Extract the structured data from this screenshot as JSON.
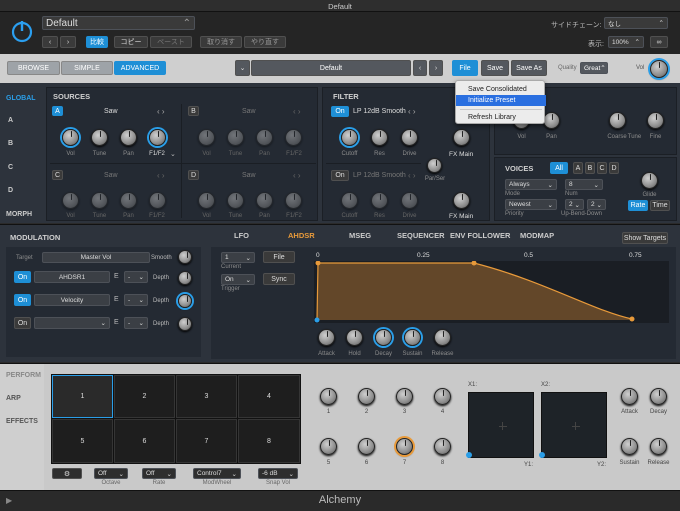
{
  "window": {
    "title": "Default",
    "footer_title": "Alchemy"
  },
  "header": {
    "preset": "Default",
    "compare": "比較",
    "copy": "コピー",
    "paste": "ペースト",
    "undo": "取り消す",
    "redo": "やり直す",
    "sidechain_label": "サイドチェーン:",
    "sidechain_value": "なし",
    "view_label": "表示:",
    "view_value": "100%"
  },
  "toolbar": {
    "browse": "BROWSE",
    "simple": "SIMPLE",
    "advanced": "ADVANCED",
    "preset_name": "Default",
    "file": "File",
    "save": "Save",
    "save_as": "Save As",
    "quality_label": "Quality",
    "quality_value": "Great",
    "vol_label": "Vol"
  },
  "file_menu": {
    "items": [
      "Save Consolidated",
      "Initialize Preset",
      "Refresh Library"
    ]
  },
  "side_nav": [
    "GLOBAL",
    "A",
    "B",
    "C",
    "D",
    "MORPH"
  ],
  "sources": {
    "title": "SOURCES",
    "slots": [
      {
        "letter": "A",
        "name": "Saw",
        "knobs": [
          "Vol",
          "Tune",
          "Pan",
          "F1/F2"
        ]
      },
      {
        "letter": "B",
        "name": "Saw",
        "knobs": [
          "Vol",
          "Tune",
          "Pan",
          "F1/F2"
        ]
      },
      {
        "letter": "C",
        "name": "Saw",
        "knobs": [
          "Vol",
          "Tune",
          "Pan",
          "F1/F2"
        ]
      },
      {
        "letter": "D",
        "name": "Saw",
        "knobs": [
          "Vol",
          "Tune",
          "Pan",
          "F1/F2"
        ]
      }
    ]
  },
  "filter": {
    "title": "FILTER",
    "filters": [
      {
        "on": "On",
        "type": "LP 12dB Smooth",
        "knobs": [
          "Cutoff",
          "Res",
          "Drive"
        ],
        "route": "FX Main"
      },
      {
        "on": "On",
        "type": "LP 12dB Smooth",
        "knobs": [
          "Cutoff",
          "Res",
          "Drive"
        ],
        "route": "FX Main"
      }
    ],
    "par_ser": "Par/Ser"
  },
  "amp": {
    "knobs": [
      "Vol",
      "Pan",
      "Coarse",
      "Tune",
      "Fine"
    ]
  },
  "voices": {
    "title": "VOICES",
    "all": "All",
    "letters": [
      "A",
      "B",
      "C",
      "D"
    ],
    "mode_value": "Always",
    "mode_label": "Mode",
    "num_value": "8",
    "num_label": "Num",
    "priority_value": "Newest",
    "priority_label": "Priority",
    "up_value": "2",
    "down_value": "2",
    "updown_label": "Up-Bend-Down",
    "glide_label": "Glide",
    "rate": "Rate",
    "time": "Time"
  },
  "modulation": {
    "title": "MODULATION",
    "target_label": "Target",
    "target_value": "Master Vol",
    "smooth_label": "Smooth",
    "rows": [
      {
        "on": "On",
        "source": "AHDSR1",
        "e": "E",
        "dash": "-",
        "depth": "Depth"
      },
      {
        "on": "On",
        "source": "Velocity",
        "e": "E",
        "dash": "-",
        "depth": "Depth"
      },
      {
        "on": "On",
        "source": "",
        "e": "E",
        "dash": "-",
        "depth": "Depth"
      }
    ]
  },
  "mod_tabs": [
    "LFO",
    "AHDSR",
    "MSEG",
    "SEQUENCER",
    "ENV FOLLOWER",
    "MODMAP"
  ],
  "show_targets": "Show Targets",
  "ahdsr": {
    "current_value": "1",
    "current_label": "Current",
    "file": "File",
    "trigger_value": "On",
    "trigger_label": "Trigger",
    "sync": "Sync",
    "ruler": [
      "0",
      "0.25",
      "0.5",
      "0.75"
    ],
    "knobs": [
      "Attack",
      "Hold",
      "Decay",
      "Sustain",
      "Release"
    ]
  },
  "perform": {
    "nav": [
      "PERFORM",
      "ARP",
      "EFFECTS"
    ],
    "pads": [
      "1",
      "2",
      "3",
      "4",
      "5",
      "6",
      "7",
      "8"
    ],
    "octave_value": "Off",
    "octave_label": "Octave",
    "rate_value": "Off",
    "rate_label": "Rate",
    "modwheel_value": "Control7",
    "modwheel_label": "ModWheel",
    "snapvol_value": "-6 dB",
    "snapvol_label": "Snap Vol",
    "knobs": [
      "1",
      "2",
      "3",
      "4",
      "5",
      "6",
      "7",
      "8"
    ],
    "xy": [
      "X1:",
      "Y1:",
      "X2:",
      "Y2:"
    ],
    "right_knobs": [
      "Attack",
      "Decay",
      "Sustain",
      "Release"
    ]
  }
}
